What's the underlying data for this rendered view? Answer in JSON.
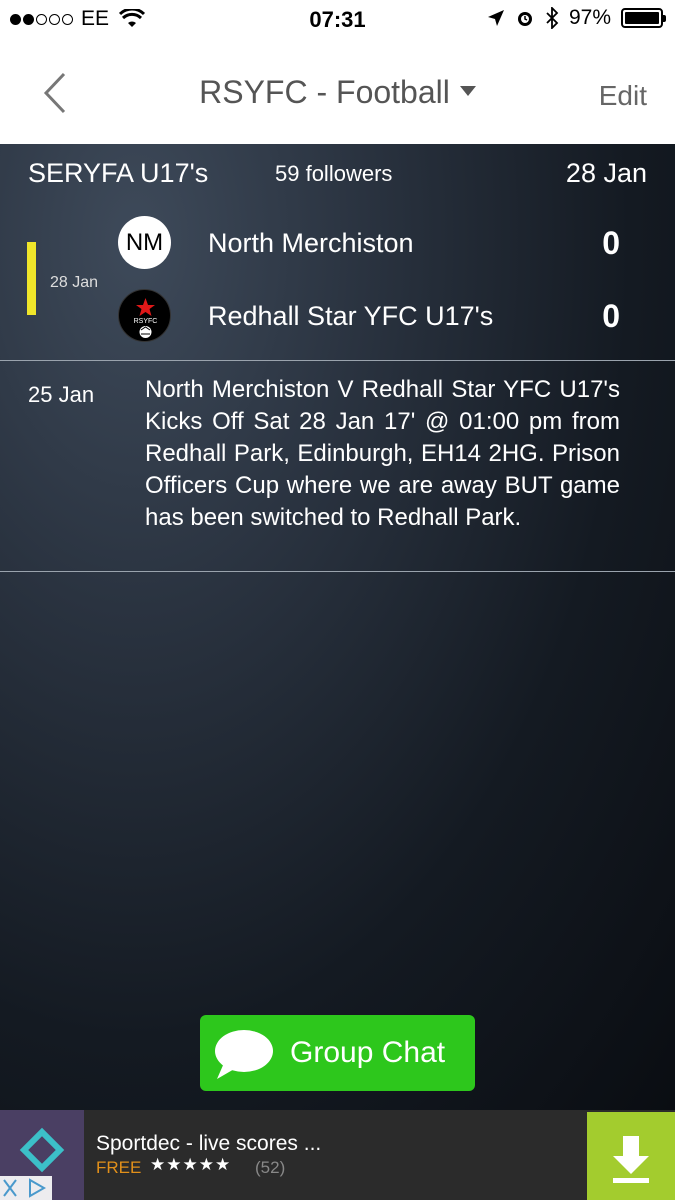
{
  "status_bar": {
    "carrier": "EE",
    "time": "07:31",
    "battery": "97%",
    "signal_bars_filled": 2,
    "signal_bars_total": 5
  },
  "nav": {
    "title": "RSYFC - Football",
    "edit_label": "Edit"
  },
  "header": {
    "competition": "SERYFA U17's",
    "followers": "59 followers",
    "date": "28 Jan"
  },
  "match": {
    "date": "28 Jan",
    "home": {
      "badge_text": "NM",
      "name": "North Merchiston",
      "score": "0"
    },
    "away": {
      "badge_text": "RSYFC",
      "name": "Redhall Star YFC U17's",
      "score": "0"
    }
  },
  "news": {
    "date": "25 Jan",
    "text": "North Merchiston V Redhall Star YFC U17's Kicks Off Sat 28 Jan 17' @ 01:00 pm from Redhall Park, Edinburgh, EH14 2HG. Prison Officers Cup where we are away BUT game has been switched to Redhall Park."
  },
  "group_chat": {
    "label": "Group Chat"
  },
  "ad": {
    "title": "Sportdec - live scores ...",
    "price": "FREE",
    "stars": "★★★★★",
    "rating_count": "(52)"
  },
  "colors": {
    "accent_yellow": "#f0e62a",
    "chat_green": "#2dc71c",
    "ad_green": "#a3cc2e"
  }
}
